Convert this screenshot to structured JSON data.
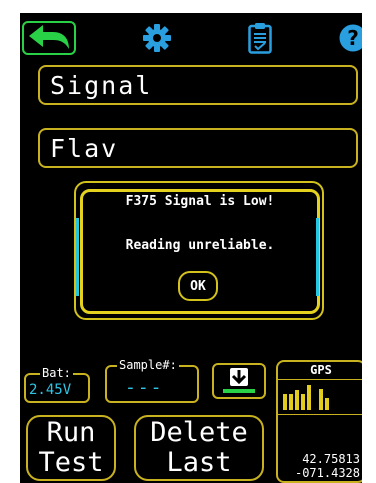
{
  "colors": {
    "accent_green": "#29d147",
    "accent_blue": "#25a8e0",
    "border_yellow": "#c9b21f",
    "value_cyan": "#2ec6e5",
    "background": "#000000"
  },
  "toolbar": {
    "back_icon": "back-arrow-icon",
    "settings_icon": "gear-icon",
    "clipboard_icon": "clipboard-check-icon",
    "help_icon": "help-icon",
    "help_symbol": "?"
  },
  "fields": {
    "signal": "Signal",
    "flav": "Flav"
  },
  "dialog": {
    "line1": "F375 Signal is Low!",
    "line2": "Reading unreliable.",
    "ok_label": "OK"
  },
  "status": {
    "battery_label": "Bat:",
    "battery_value": "2.45V",
    "sample_label": "Sample#:",
    "sample_value": "---",
    "download_icon": "download-arrow-icon"
  },
  "gps": {
    "title": "GPS",
    "signal_bar_levels": [
      0.6,
      0.6,
      0.75,
      0.6,
      0.95,
      0,
      0.8,
      0.45
    ],
    "latitude": "42.75813",
    "longitude": "-071.4328"
  },
  "buttons": {
    "run_line1": "Run",
    "run_line2": "Test",
    "delete_line1": "Delete",
    "delete_line2": "Last"
  }
}
